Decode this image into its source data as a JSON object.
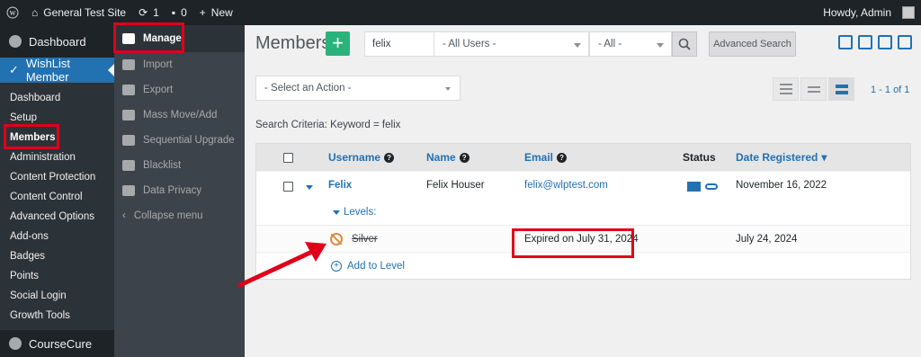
{
  "adminbar": {
    "site_name": "General Test Site",
    "updates_count": "1",
    "comments_count": "0",
    "new_label": "New",
    "howdy": "Howdy, Admin"
  },
  "sidebar": {
    "dashboard": "Dashboard",
    "wishlist": "WishList Member",
    "items": [
      "Dashboard",
      "Setup",
      "Members",
      "Administration",
      "Content Protection",
      "Content Control",
      "Advanced Options",
      "Add-ons",
      "Badges",
      "Points",
      "Social Login",
      "Growth Tools"
    ],
    "current_item": "Members",
    "coursecure": "CourseCure"
  },
  "submenu": {
    "items": [
      "Manage",
      "Import",
      "Export",
      "Mass Move/Add",
      "Sequential Upgrade",
      "Blacklist",
      "Data Privacy",
      "Collapse menu"
    ],
    "active": "Manage"
  },
  "toolbar": {
    "title": "Members",
    "add_symbol": "+",
    "search_value": "felix",
    "users_filter": "- All Users -",
    "status_filter": "- All -",
    "advanced_search": "Advanced Search",
    "icons": [
      "video-icon",
      "search-doc-icon",
      "user-card-icon",
      "chat-icon"
    ]
  },
  "actions": {
    "select_placeholder": "- Select an Action -",
    "pager_text": "1 - 1 of 1"
  },
  "search_criteria": "Search Criteria: Keyword = felix",
  "table": {
    "columns": {
      "username": "Username",
      "name": "Name",
      "email": "Email",
      "status": "Status",
      "date_registered": "Date Registered"
    },
    "member": {
      "username": "Felix",
      "name": "Felix Houser",
      "email": "felix@wlptest.com",
      "date_registered": "November 16, 2022"
    },
    "levels_label": "Levels:",
    "level": {
      "name": "Silver",
      "status": "Expired on July 31, 2024",
      "date": "July 24, 2024"
    },
    "add_to_level": "Add to Level"
  },
  "colors": {
    "accent": "#2271b1",
    "highlight": "#e0001a",
    "add_button": "#2ab27b",
    "expired_icon": "#e08a3a"
  }
}
